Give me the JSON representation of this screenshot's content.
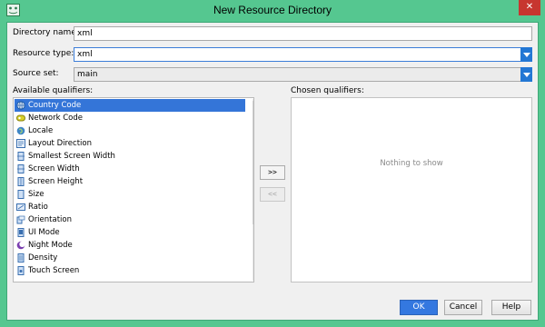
{
  "window": {
    "title": "New Resource Directory",
    "close_label": "✕"
  },
  "form": {
    "directory_name_label": "Directory name:",
    "directory_name_value": "xml",
    "resource_type_label": "Resource type:",
    "resource_type_value": "xml",
    "source_set_label": "Source set:",
    "source_set_value": "main"
  },
  "available": {
    "label": "Available qualifiers:",
    "selected": "Country Code",
    "items": [
      {
        "label": "Country Code",
        "icon": "globe-icon"
      },
      {
        "label": "Network Code",
        "icon": "network-code-icon"
      },
      {
        "label": "Locale",
        "icon": "locale-icon"
      },
      {
        "label": "Layout Direction",
        "icon": "layout-direction-icon"
      },
      {
        "label": "Smallest Screen Width",
        "icon": "screen-width-icon"
      },
      {
        "label": "Screen Width",
        "icon": "screen-width-icon"
      },
      {
        "label": "Screen Height",
        "icon": "screen-height-icon"
      },
      {
        "label": "Size",
        "icon": "size-icon"
      },
      {
        "label": "Ratio",
        "icon": "ratio-icon"
      },
      {
        "label": "Orientation",
        "icon": "orientation-icon"
      },
      {
        "label": "UI Mode",
        "icon": "ui-mode-icon"
      },
      {
        "label": "Night Mode",
        "icon": "night-mode-icon"
      },
      {
        "label": "Density",
        "icon": "density-icon"
      },
      {
        "label": "Touch Screen",
        "icon": "touch-screen-icon"
      }
    ]
  },
  "chosen": {
    "label": "Chosen qualifiers:",
    "empty_text": "Nothing to show"
  },
  "transfer": {
    "add_label": ">>",
    "remove_label": "<<"
  },
  "buttons": {
    "ok": "OK",
    "cancel": "Cancel",
    "help": "Help"
  },
  "colors": {
    "window_frame": "#55c790",
    "selection": "#3475d8",
    "dropdown_accent": "#2377d4",
    "close_button": "#c7362f",
    "ok_button": "#3478e0"
  }
}
